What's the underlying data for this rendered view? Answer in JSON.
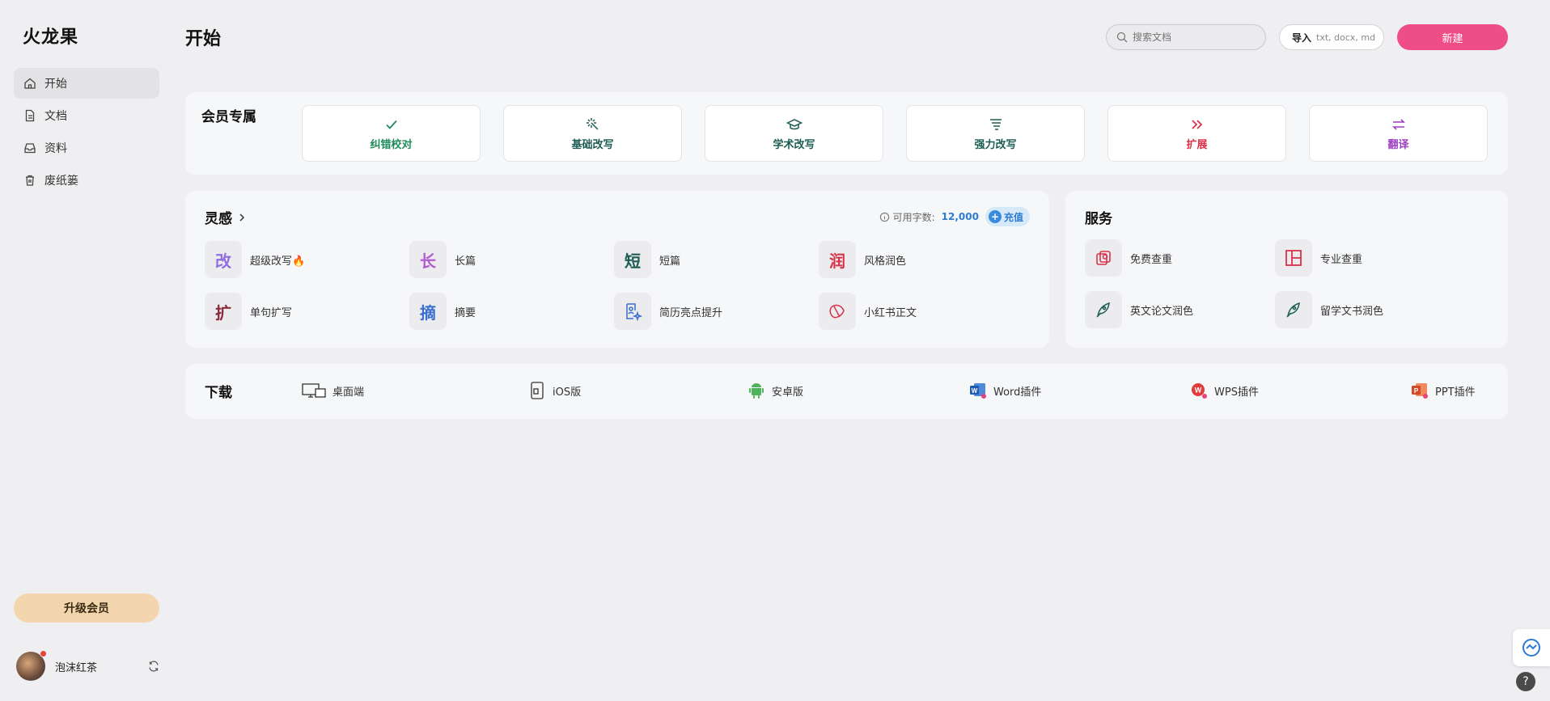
{
  "app": {
    "logo": "火龙果"
  },
  "sidebar": {
    "items": [
      {
        "label": "开始",
        "icon": "home-icon"
      },
      {
        "label": "文档",
        "icon": "document-icon"
      },
      {
        "label": "资料",
        "icon": "inbox-icon"
      },
      {
        "label": "废纸篓",
        "icon": "trash-icon"
      }
    ],
    "upgrade_label": "升级会员",
    "user_name": "泡沫红茶"
  },
  "header": {
    "title": "开始",
    "search_placeholder": "搜索文档",
    "import_label": "导入",
    "import_hint": "txt, docx, md",
    "new_label": "新建"
  },
  "member": {
    "title": "会员专属",
    "cards": [
      {
        "label": "纠错校对",
        "icon": "check-icon",
        "color": "#1f8a5b"
      },
      {
        "label": "基础改写",
        "icon": "magic-wand-icon",
        "color": "#1d5c52"
      },
      {
        "label": "学术改写",
        "icon": "graduation-cap-icon",
        "color": "#1d5c52"
      },
      {
        "label": "强力改写",
        "icon": "tornado-icon",
        "color": "#1d5c52"
      },
      {
        "label": "扩展",
        "icon": "double-chevron-icon",
        "color": "#d8334a"
      },
      {
        "label": "翻译",
        "icon": "swap-arrows-icon",
        "color": "#9b3fbf"
      }
    ]
  },
  "inspiration": {
    "title": "灵感",
    "quota_label": "可用字数:",
    "quota_value": "12,000",
    "recharge_label": "充值",
    "tools": [
      {
        "label": "超级改写",
        "glyph": "改",
        "color": "#8f6ee0",
        "badge": "🔥"
      },
      {
        "label": "长篇",
        "glyph": "长",
        "color": "#b35bd0"
      },
      {
        "label": "短篇",
        "glyph": "短",
        "color": "#1d5c52"
      },
      {
        "label": "风格润色",
        "glyph": "润",
        "color": "#d8334a"
      },
      {
        "label": "单句扩写",
        "glyph": "扩",
        "color": "#8a2a3a"
      },
      {
        "label": "摘要",
        "glyph": "摘",
        "color": "#3a6fd0"
      },
      {
        "label": "简历亮点提升",
        "glyph": "",
        "icon": "resume-sparkle-icon",
        "color": "#3a6fd0"
      },
      {
        "label": "小红书正文",
        "glyph": "",
        "icon": "leaf-icon",
        "color": "#d8334a"
      }
    ]
  },
  "service": {
    "title": "服务",
    "tools": [
      {
        "label": "免费查重",
        "icon": "duplicate-check-icon",
        "color": "#d8334a"
      },
      {
        "label": "专业查重",
        "icon": "layout-panel-icon",
        "color": "#d8334a"
      },
      {
        "label": "英文论文润色",
        "icon": "quill-pen-icon",
        "color": "#1d5c52"
      },
      {
        "label": "留学文书润色",
        "icon": "quill-pen-icon",
        "color": "#1d5c52"
      }
    ]
  },
  "download": {
    "title": "下载",
    "items": [
      {
        "label": "桌面端",
        "icon": "desktop-icon"
      },
      {
        "label": "iOS版",
        "icon": "phone-icon"
      },
      {
        "label": "安卓版",
        "icon": "android-icon"
      },
      {
        "label": "Word插件",
        "icon": "word-icon"
      },
      {
        "label": "WPS插件",
        "icon": "wps-icon"
      },
      {
        "label": "PPT插件",
        "icon": "ppt-icon"
      }
    ]
  },
  "float": {
    "help_label": "?"
  }
}
